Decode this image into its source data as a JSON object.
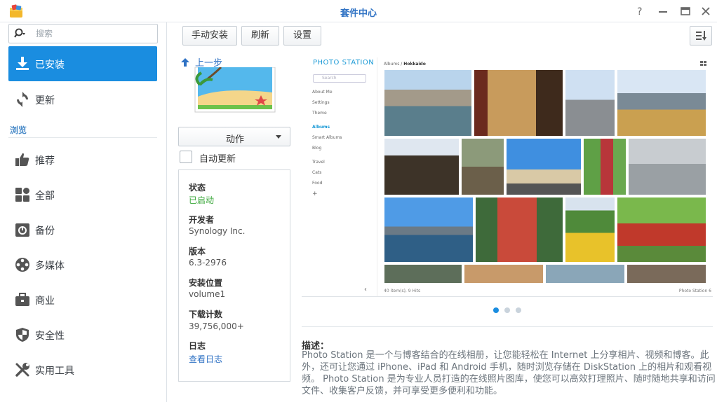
{
  "window": {
    "title": "套件中心",
    "controls": [
      "help-icon",
      "minimize-icon",
      "maximize-icon",
      "close-icon"
    ]
  },
  "sidebar": {
    "search_placeholder": "搜索",
    "installed_label": "已安装",
    "update_label": "更新",
    "browse_title": "浏览",
    "items": [
      {
        "label": "推荐",
        "icon": "thumbs-up-icon"
      },
      {
        "label": "全部",
        "icon": "grid-icon"
      },
      {
        "label": "备份",
        "icon": "backup-icon"
      },
      {
        "label": "多媒体",
        "icon": "film-reel-icon"
      },
      {
        "label": "商业",
        "icon": "briefcase-icon"
      },
      {
        "label": "安全性",
        "icon": "shield-icon"
      },
      {
        "label": "实用工具",
        "icon": "tools-icon"
      }
    ]
  },
  "toolbar": {
    "manual_install": "手动安装",
    "refresh": "刷新",
    "settings": "设置"
  },
  "detail": {
    "back_label": "上一步",
    "action_label": "动作",
    "auto_update_label": "自动更新",
    "info": [
      {
        "key": "状态",
        "value": "已启动",
        "style": "green"
      },
      {
        "key": "开发者",
        "value": "Synology Inc.",
        "style": "plain"
      },
      {
        "key": "版本",
        "value": "6.3-2976",
        "style": "plain"
      },
      {
        "key": "安装位置",
        "value": "volume1",
        "style": "plain"
      },
      {
        "key": "下载计数",
        "value": "39,756,000+",
        "style": "plain"
      },
      {
        "key": "日志",
        "value": "查看日志",
        "style": "link"
      }
    ]
  },
  "preview": {
    "logo": "PHOTO STATION",
    "search_placeholder": "Search",
    "nav": [
      "About Me",
      "Settings",
      "Theme",
      "Albums",
      "Smart Albums",
      "Blog",
      "Travel",
      "Cats",
      "Food",
      "+"
    ],
    "active_nav": "Albums",
    "crumb_root": "Albums",
    "crumb_current": "Hokkaido",
    "footer_left": "40 item(s), 9 Hits",
    "footer_right": "Photo Station 6",
    "carousel_dots": 3,
    "carousel_active": 0
  },
  "description": {
    "title": "描述：",
    "text": "Photo Station 是一个与博客结合的在线相册，让您能轻松在 Internet 上分享相片、视频和博客。此外，还可让您通过 iPhone、iPad 和 Android 手机，随时浏览存储在 DiskStation 上的相片和观看视频。 Photo Station 是为专业人员打造的在线照片图库，使您可以高效打理照片、随时随地共享和访问文件、收集客户反馈，并可享受更多便利和功能。"
  }
}
